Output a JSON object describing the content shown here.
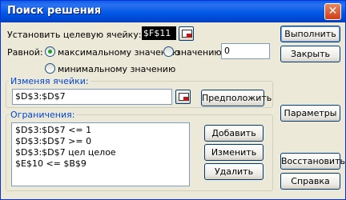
{
  "window": {
    "title": "Поиск решения"
  },
  "target": {
    "label": "Установить целевую ячейку:",
    "value": "$F$11"
  },
  "equal": {
    "label": "Равной:",
    "max_label": "максимальному значению",
    "value_label": "значению:",
    "value_input": "0",
    "min_label": "минимальному значению",
    "selected": "max"
  },
  "changing": {
    "label": "Изменяя ячейки:",
    "value": "$D$3:$D$7",
    "guess_label": "Предположить"
  },
  "constraints": {
    "label": "Ограничения:",
    "items": [
      "$D$3:$D$7 <= 1",
      "$D$3:$D$7 >= 0",
      "$D$3:$D$7 цел целое",
      "$E$10 <= $B$9"
    ],
    "add_label": "Добавить",
    "change_label": "Изменить",
    "delete_label": "Удалить"
  },
  "buttons": {
    "solve": "Выполнить",
    "close": "Закрыть",
    "options": "Параметры",
    "reset": "Восстановить",
    "help": "Справка"
  },
  "icons": {
    "close": "close-icon",
    "range_select": "range-select-icon"
  },
  "colors": {
    "titlebar": "#0054e3",
    "accent": "#0046d5"
  }
}
